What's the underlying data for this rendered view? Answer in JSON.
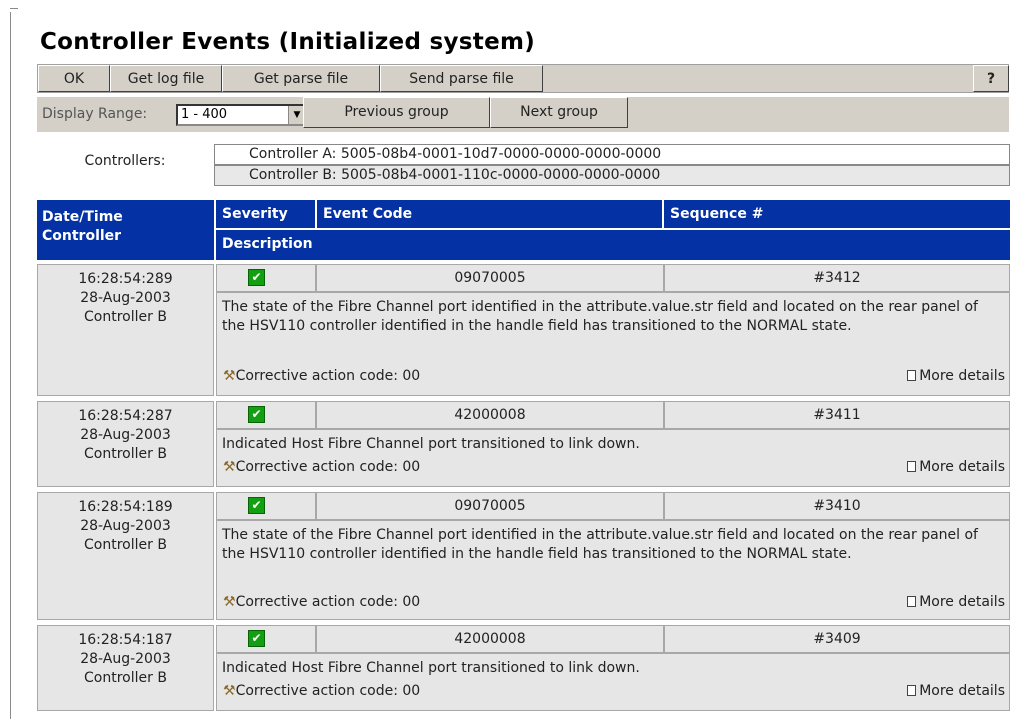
{
  "title": "Controller Events (Initialized system)",
  "toolbar": {
    "ok": "OK",
    "get_log": "Get log file",
    "get_parse": "Get parse file",
    "send_parse": "Send parse file",
    "help": "?"
  },
  "range": {
    "label": "Display Range:",
    "selected": "1 - 400",
    "prev": "Previous group",
    "next": "Next group"
  },
  "controllers": {
    "label": "Controllers:",
    "a": "Controller A: 5005-08b4-0001-10d7-0000-0000-0000-0000",
    "b": "Controller B: 5005-08b4-0001-110c-0000-0000-0000-0000"
  },
  "headers": {
    "datetime_line1": "Date/Time",
    "datetime_line2": "Controller",
    "severity": "Severity",
    "event_code": "Event Code",
    "sequence": "Sequence #",
    "description": "Description"
  },
  "events": [
    {
      "time": "16:28:54:289",
      "date": "28-Aug-2003",
      "controller": "Controller B",
      "code": "09070005",
      "sequence": "#3412",
      "description": "The state of the Fibre Channel port identified in the attribute.value.str field and located on the rear panel of the HSV110 controller identified in the handle field has transitioned to the NORMAL state.",
      "corrective": "Corrective action code: 00",
      "more": "More details"
    },
    {
      "time": "16:28:54:287",
      "date": "28-Aug-2003",
      "controller": "Controller B",
      "code": "42000008",
      "sequence": "#3411",
      "description": "Indicated Host Fibre Channel port transitioned to link down.",
      "corrective": "Corrective action code: 00",
      "more": "More details"
    },
    {
      "time": "16:28:54:189",
      "date": "28-Aug-2003",
      "controller": "Controller B",
      "code": "09070005",
      "sequence": "#3410",
      "description": "The state of the Fibre Channel port identified in the attribute.value.str field and located on the rear panel of the HSV110 controller identified in the handle field has transitioned to the NORMAL state.",
      "corrective": "Corrective action code: 00",
      "more": "More details"
    },
    {
      "time": "16:28:54:187",
      "date": "28-Aug-2003",
      "controller": "Controller B",
      "code": "42000008",
      "sequence": "#3409",
      "description": "Indicated Host Fibre Channel port transitioned to link down.",
      "corrective": "Corrective action code: 00",
      "more": "More details"
    }
  ]
}
